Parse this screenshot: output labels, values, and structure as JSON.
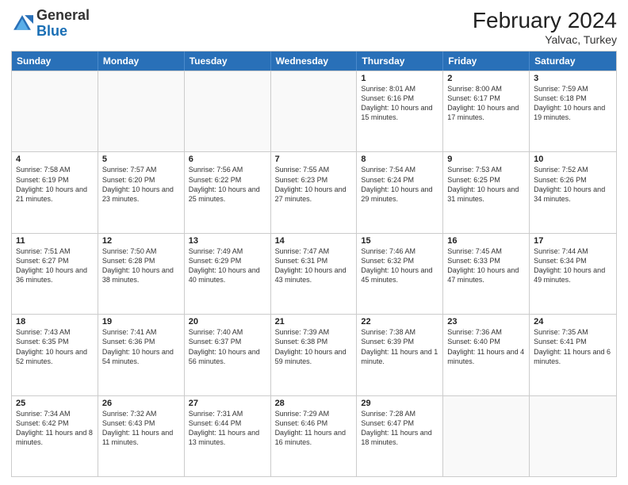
{
  "header": {
    "logo_general": "General",
    "logo_blue": "Blue",
    "month_year": "February 2024",
    "location": "Yalvac, Turkey"
  },
  "days_of_week": [
    "Sunday",
    "Monday",
    "Tuesday",
    "Wednesday",
    "Thursday",
    "Friday",
    "Saturday"
  ],
  "weeks": [
    [
      {
        "day": "",
        "empty": true
      },
      {
        "day": "",
        "empty": true
      },
      {
        "day": "",
        "empty": true
      },
      {
        "day": "",
        "empty": true
      },
      {
        "day": "1",
        "sunrise": "8:01 AM",
        "sunset": "6:16 PM",
        "daylight": "10 hours and 15 minutes."
      },
      {
        "day": "2",
        "sunrise": "8:00 AM",
        "sunset": "6:17 PM",
        "daylight": "10 hours and 17 minutes."
      },
      {
        "day": "3",
        "sunrise": "7:59 AM",
        "sunset": "6:18 PM",
        "daylight": "10 hours and 19 minutes."
      }
    ],
    [
      {
        "day": "4",
        "sunrise": "7:58 AM",
        "sunset": "6:19 PM",
        "daylight": "10 hours and 21 minutes."
      },
      {
        "day": "5",
        "sunrise": "7:57 AM",
        "sunset": "6:20 PM",
        "daylight": "10 hours and 23 minutes."
      },
      {
        "day": "6",
        "sunrise": "7:56 AM",
        "sunset": "6:22 PM",
        "daylight": "10 hours and 25 minutes."
      },
      {
        "day": "7",
        "sunrise": "7:55 AM",
        "sunset": "6:23 PM",
        "daylight": "10 hours and 27 minutes."
      },
      {
        "day": "8",
        "sunrise": "7:54 AM",
        "sunset": "6:24 PM",
        "daylight": "10 hours and 29 minutes."
      },
      {
        "day": "9",
        "sunrise": "7:53 AM",
        "sunset": "6:25 PM",
        "daylight": "10 hours and 31 minutes."
      },
      {
        "day": "10",
        "sunrise": "7:52 AM",
        "sunset": "6:26 PM",
        "daylight": "10 hours and 34 minutes."
      }
    ],
    [
      {
        "day": "11",
        "sunrise": "7:51 AM",
        "sunset": "6:27 PM",
        "daylight": "10 hours and 36 minutes."
      },
      {
        "day": "12",
        "sunrise": "7:50 AM",
        "sunset": "6:28 PM",
        "daylight": "10 hours and 38 minutes."
      },
      {
        "day": "13",
        "sunrise": "7:49 AM",
        "sunset": "6:29 PM",
        "daylight": "10 hours and 40 minutes."
      },
      {
        "day": "14",
        "sunrise": "7:47 AM",
        "sunset": "6:31 PM",
        "daylight": "10 hours and 43 minutes."
      },
      {
        "day": "15",
        "sunrise": "7:46 AM",
        "sunset": "6:32 PM",
        "daylight": "10 hours and 45 minutes."
      },
      {
        "day": "16",
        "sunrise": "7:45 AM",
        "sunset": "6:33 PM",
        "daylight": "10 hours and 47 minutes."
      },
      {
        "day": "17",
        "sunrise": "7:44 AM",
        "sunset": "6:34 PM",
        "daylight": "10 hours and 49 minutes."
      }
    ],
    [
      {
        "day": "18",
        "sunrise": "7:43 AM",
        "sunset": "6:35 PM",
        "daylight": "10 hours and 52 minutes."
      },
      {
        "day": "19",
        "sunrise": "7:41 AM",
        "sunset": "6:36 PM",
        "daylight": "10 hours and 54 minutes."
      },
      {
        "day": "20",
        "sunrise": "7:40 AM",
        "sunset": "6:37 PM",
        "daylight": "10 hours and 56 minutes."
      },
      {
        "day": "21",
        "sunrise": "7:39 AM",
        "sunset": "6:38 PM",
        "daylight": "10 hours and 59 minutes."
      },
      {
        "day": "22",
        "sunrise": "7:38 AM",
        "sunset": "6:39 PM",
        "daylight": "11 hours and 1 minute."
      },
      {
        "day": "23",
        "sunrise": "7:36 AM",
        "sunset": "6:40 PM",
        "daylight": "11 hours and 4 minutes."
      },
      {
        "day": "24",
        "sunrise": "7:35 AM",
        "sunset": "6:41 PM",
        "daylight": "11 hours and 6 minutes."
      }
    ],
    [
      {
        "day": "25",
        "sunrise": "7:34 AM",
        "sunset": "6:42 PM",
        "daylight": "11 hours and 8 minutes."
      },
      {
        "day": "26",
        "sunrise": "7:32 AM",
        "sunset": "6:43 PM",
        "daylight": "11 hours and 11 minutes."
      },
      {
        "day": "27",
        "sunrise": "7:31 AM",
        "sunset": "6:44 PM",
        "daylight": "11 hours and 13 minutes."
      },
      {
        "day": "28",
        "sunrise": "7:29 AM",
        "sunset": "6:46 PM",
        "daylight": "11 hours and 16 minutes."
      },
      {
        "day": "29",
        "sunrise": "7:28 AM",
        "sunset": "6:47 PM",
        "daylight": "11 hours and 18 minutes."
      },
      {
        "day": "",
        "empty": true
      },
      {
        "day": "",
        "empty": true
      }
    ]
  ]
}
